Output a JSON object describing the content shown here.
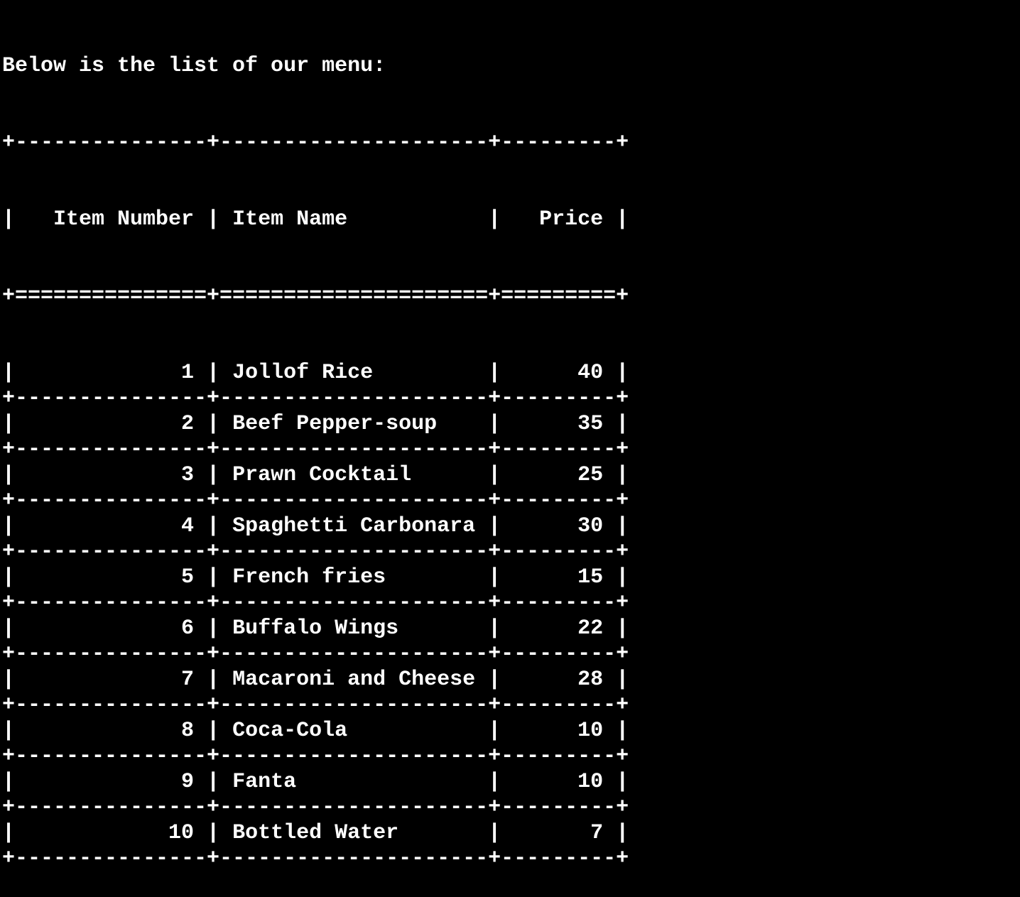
{
  "terminal": {
    "intro_text": "Below is the list of our menu:",
    "headers": {
      "item_number": "Item Number",
      "item_name": "Item Name",
      "price": "Price"
    },
    "rows": [
      {
        "number": "1",
        "name": "Jollof Rice",
        "price": "40"
      },
      {
        "number": "2",
        "name": "Beef Pepper-soup",
        "price": "35"
      },
      {
        "number": "3",
        "name": "Prawn Cocktail",
        "price": "25"
      },
      {
        "number": "4",
        "name": "Spaghetti Carbonara",
        "price": "30"
      },
      {
        "number": "5",
        "name": "French fries",
        "price": "15"
      },
      {
        "number": "6",
        "name": "Buffalo Wings",
        "price": "22"
      },
      {
        "number": "7",
        "name": "Macaroni and Cheese",
        "price": "28"
      },
      {
        "number": "8",
        "name": "Coca-Cola",
        "price": "10"
      },
      {
        "number": "9",
        "name": "Fanta",
        "price": "10"
      },
      {
        "number": "10",
        "name": "Bottled Water",
        "price": "7"
      }
    ],
    "colors": {
      "background": "#000000",
      "foreground": "#ffffff"
    }
  }
}
